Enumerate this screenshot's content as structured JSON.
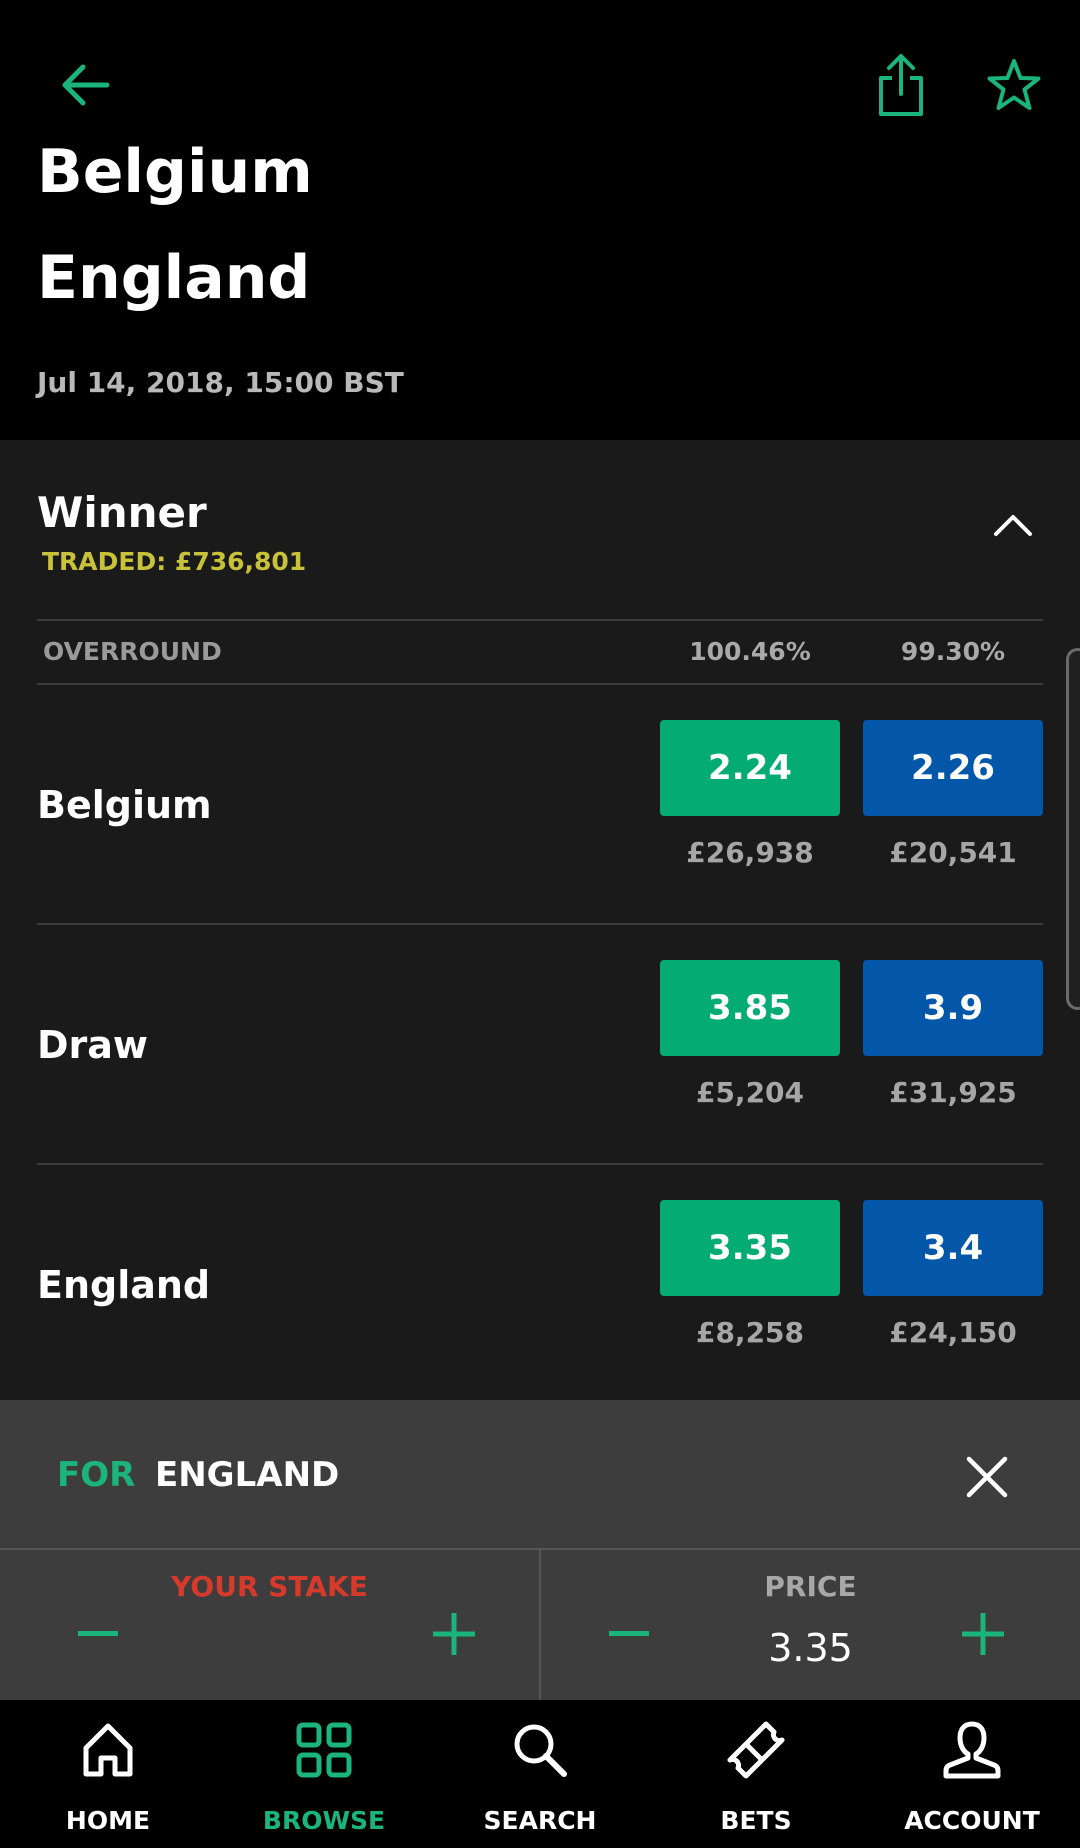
{
  "header": {
    "title_partial": "Belgium",
    "title": "England",
    "date": "Jul 14, 2018, 15:00 BST"
  },
  "market": {
    "name": "Winner",
    "traded": "TRADED:  £736,801",
    "overround": {
      "label": "OVERROUND",
      "back": "100.46%",
      "lay": "99.30%"
    },
    "runners": [
      {
        "name": "Belgium",
        "back_price": "2.24",
        "back_volume": "£26,938",
        "lay_price": "2.26",
        "lay_volume": "£20,541"
      },
      {
        "name": "Draw",
        "back_price": "3.85",
        "back_volume": "£5,204",
        "lay_price": "3.9",
        "lay_volume": "£31,925"
      },
      {
        "name": "England",
        "back_price": "3.35",
        "back_volume": "£8,258",
        "lay_price": "3.4",
        "lay_volume": "£24,150"
      }
    ]
  },
  "betslip": {
    "for_label": "FOR",
    "selection": "ENGLAND",
    "stake_label": "YOUR STAKE",
    "stake_value": "",
    "price_label": "PRICE",
    "price_value": "3.35"
  },
  "nav": {
    "items": [
      {
        "label": "HOME",
        "icon": "home-icon",
        "active": false
      },
      {
        "label": "BROWSE",
        "icon": "grid-icon",
        "active": true
      },
      {
        "label": "SEARCH",
        "icon": "search-icon",
        "active": false
      },
      {
        "label": "BETS",
        "icon": "ticket-icon",
        "active": false
      },
      {
        "label": "ACCOUNT",
        "icon": "user-icon",
        "active": false
      }
    ]
  },
  "colors": {
    "back": "#04ac74",
    "lay": "#0456a8",
    "accent": "#1bb47f",
    "traded": "#c7c23a",
    "stake_label": "#d53a2b"
  }
}
